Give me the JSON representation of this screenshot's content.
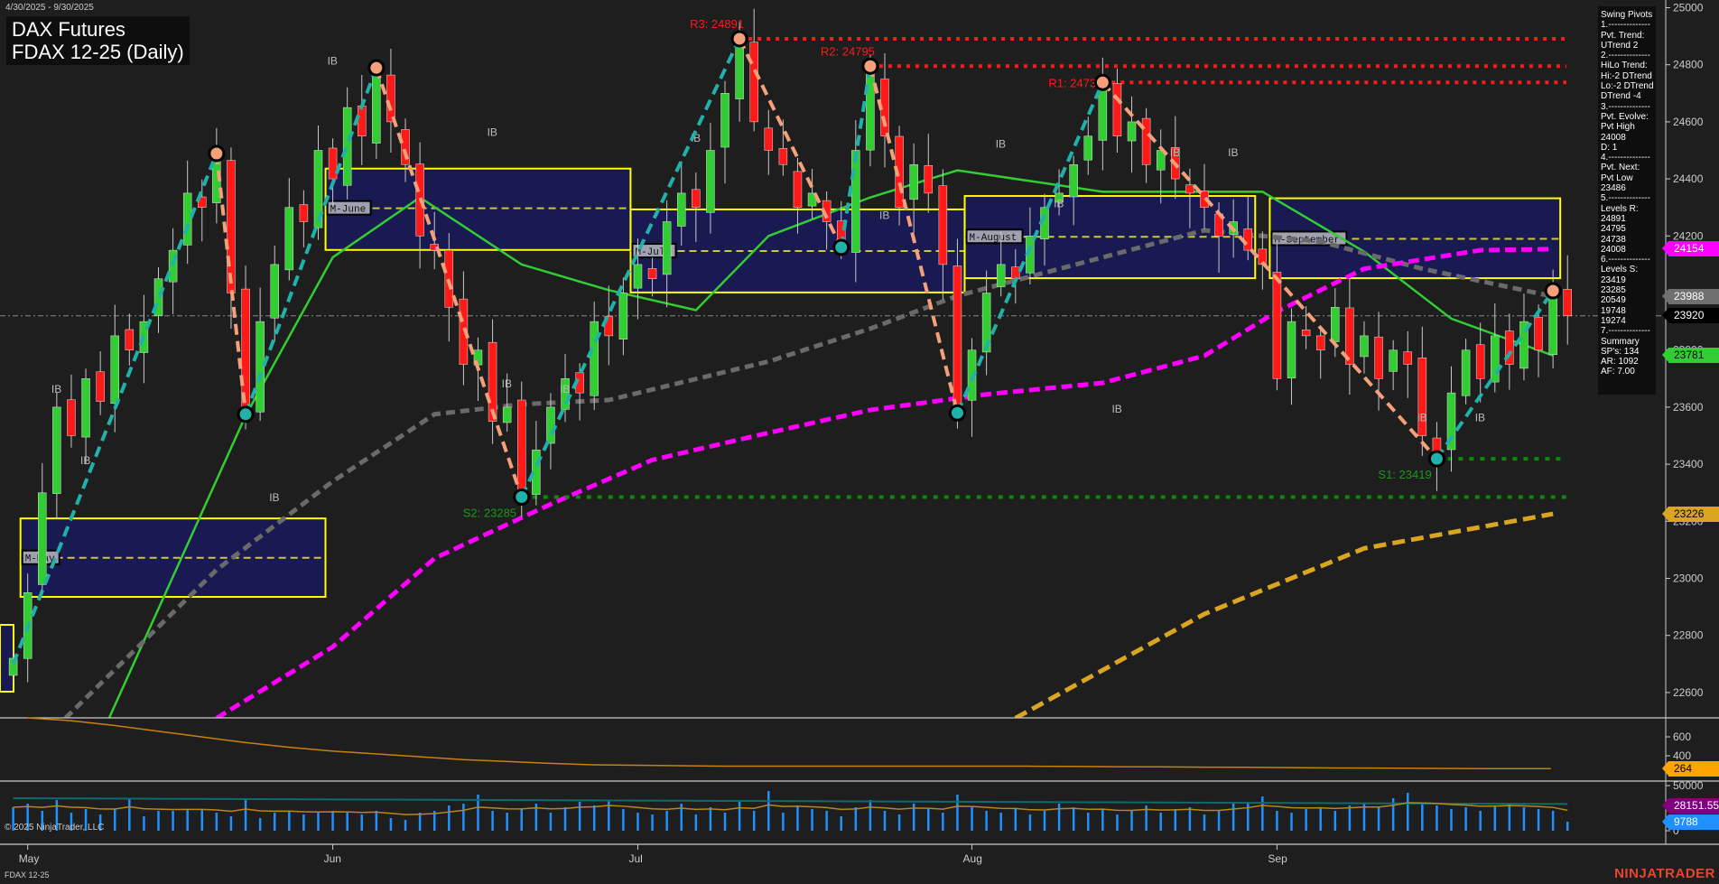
{
  "header": {
    "date_range": "4/30/2025 - 9/30/2025",
    "title": "DAX Futures",
    "subtitle": "FDAX 12-25 (Daily)"
  },
  "info_panel": {
    "lines": [
      "Swing Pivots",
      "1.--------------",
      "Pvt. Trend:",
      "UTrend 2",
      "2.--------------",
      "HiLo Trend:",
      "Hi:-2 DTrend",
      "Lo:-2 DTrend",
      "DTrend -4",
      "3.--------------",
      "Pvt. Evolve:",
      "Pvt High",
      "24008",
      "D: 1",
      "4.--------------",
      "Pvt. Next:",
      "Pvt Low",
      "23486",
      "5.--------------",
      "Levels R:",
      "24891",
      "24795",
      "24738",
      "24008",
      "6.--------------",
      "Levels S:",
      "23419",
      "23285",
      "20549",
      "19748",
      "19274",
      "7.--------------",
      "Summary",
      "SP's: 134",
      "AR: 1092",
      "AF: 7.00"
    ]
  },
  "footer": {
    "copyright": "© 2025 NinjaTrader, LLC",
    "symbol": "FDAX 12-25",
    "logo": "NINJATRADER"
  },
  "price_tags": [
    {
      "value": "24154",
      "bg": "#ff00ff",
      "fg": "#ffffff"
    },
    {
      "value": "23988",
      "bg": "#707070",
      "fg": "#ffffff"
    },
    {
      "value": "23920",
      "bg": "#000000",
      "fg": "#ffffff"
    },
    {
      "value": "23781",
      "bg": "#32cd32",
      "fg": "#000000"
    },
    {
      "value": "23226",
      "bg": "#daa520",
      "fg": "#000000"
    }
  ],
  "indicator_tags": [
    {
      "value": "264",
      "bg": "#ffa500",
      "fg": "#000000",
      "panel": "ind",
      "v": 264
    },
    {
      "value": "28151.55",
      "bg": "#800080",
      "fg": "#ffffff",
      "panel": "vol",
      "v": 28151
    },
    {
      "value": "9788",
      "bg": "#1e90ff",
      "fg": "#ffffff",
      "panel": "vol",
      "v": 9788
    }
  ],
  "chart_data": {
    "type": "candlestick",
    "title": "FDAX 12-25 (Daily)",
    "y_ticks": [
      22600,
      22800,
      23000,
      23200,
      23400,
      23600,
      23800,
      24000,
      24200,
      24400,
      24600,
      24800,
      25000
    ],
    "ylim": [
      22510,
      25030
    ],
    "x_labels": [
      {
        "label": "May",
        "bar": 1
      },
      {
        "label": "Jun",
        "bar": 22
      },
      {
        "label": "Jul",
        "bar": 43
      },
      {
        "label": "Aug",
        "bar": 66
      },
      {
        "label": "Sep",
        "bar": 87
      }
    ],
    "last_price": 23920,
    "closes": [
      22720,
      22950,
      23300,
      23600,
      23500,
      23700,
      23620,
      23850,
      23800,
      23900,
      24050,
      24150,
      24350,
      24300,
      24480,
      24000,
      23600,
      23900,
      24100,
      24300,
      24250,
      24500,
      24400,
      24650,
      24550,
      24760,
      24600,
      24450,
      24200,
      24150,
      23950,
      23750,
      23800,
      23550,
      23600,
      23300,
      23450,
      23600,
      23700,
      23650,
      23900,
      23850,
      24000,
      24100,
      24050,
      24250,
      24350,
      24300,
      24500,
      24700,
      24870,
      24600,
      24500,
      24450,
      24300,
      24350,
      24250,
      24170,
      24500,
      24780,
      24550,
      24300,
      24450,
      24350,
      24100,
      23600,
      23800,
      24000,
      24100,
      24050,
      24200,
      24300,
      24350,
      24450,
      24550,
      24720,
      24550,
      24600,
      24450,
      24500,
      24400,
      24350,
      24300,
      24200,
      24250,
      24150,
      24100,
      23700,
      23900,
      23850,
      23800,
      23950,
      23750,
      23850,
      23700,
      23800,
      23750,
      23500,
      23430,
      23650,
      23800,
      23700,
      23850,
      23750,
      23900,
      23800,
      24000,
      23920
    ],
    "swing_pivots": [
      [
        0,
        22700
      ],
      [
        14,
        24489
      ],
      [
        16,
        23575
      ],
      [
        25,
        24789
      ],
      [
        35,
        23285
      ],
      [
        50,
        24891
      ],
      [
        57,
        24160
      ],
      [
        59,
        24795
      ],
      [
        65,
        23580
      ],
      [
        75,
        24738
      ],
      [
        98,
        23419
      ],
      [
        106,
        24008
      ]
    ],
    "resistance": [
      {
        "label": "R3: 24891",
        "value": 24891,
        "from": 50
      },
      {
        "label": "R2: 24795",
        "value": 24795,
        "from": 59
      },
      {
        "label": "R1: 24738",
        "value": 24738,
        "from": 75
      }
    ],
    "support": [
      {
        "label": "S2: 23285",
        "value": 23285,
        "from": 35
      },
      {
        "label": "S1: 23419",
        "value": 23419,
        "from": 98
      }
    ],
    "monthly_boxes": [
      {
        "label": "M-May",
        "from": 1,
        "to": 21,
        "high": 23210,
        "low": 22935,
        "mid": 23072
      },
      {
        "label": "M-June",
        "from": 22,
        "to": 42,
        "high": 24436,
        "low": 24151,
        "mid": 24297
      },
      {
        "label": "M-July",
        "from": 43,
        "to": 65,
        "high": 24293,
        "low": 24002,
        "mid": 24147
      },
      {
        "label": "M-August",
        "from": 66,
        "to": 85,
        "high": 24340,
        "low": 24052,
        "mid": 24197
      },
      {
        "label": "M-September",
        "from": 87,
        "to": 106,
        "high": 24332,
        "low": 24052,
        "mid": 24190
      }
    ],
    "moving_averages": [
      {
        "name": "fast",
        "color": "#32cd32",
        "dash": "",
        "points": [
          [
            6.6,
            22510
          ],
          [
            16,
            23570
          ],
          [
            22,
            24125
          ],
          [
            28,
            24335
          ],
          [
            35,
            24100
          ],
          [
            41,
            24010
          ],
          [
            47,
            23940
          ],
          [
            52,
            24200
          ],
          [
            59,
            24335
          ],
          [
            65,
            24430
          ],
          [
            75,
            24355
          ],
          [
            86,
            24355
          ],
          [
            93,
            24145
          ],
          [
            99,
            23910
          ],
          [
            106,
            23781
          ]
        ]
      },
      {
        "name": "mid",
        "color": "#6a6a6a",
        "dash": "10 6",
        "points": [
          [
            3.6,
            22510
          ],
          [
            14,
            23030
          ],
          [
            22,
            23340
          ],
          [
            29,
            23575
          ],
          [
            35,
            23610
          ],
          [
            41,
            23625
          ],
          [
            52,
            23760
          ],
          [
            59,
            23875
          ],
          [
            65,
            23990
          ],
          [
            75,
            24125
          ],
          [
            82,
            24220
          ],
          [
            90,
            24180
          ],
          [
            97,
            24085
          ],
          [
            106,
            23988
          ]
        ]
      },
      {
        "name": "slow",
        "color": "#ff00ff",
        "dash": "12 6",
        "points": [
          [
            14,
            22510
          ],
          [
            22,
            22760
          ],
          [
            29,
            23070
          ],
          [
            37,
            23260
          ],
          [
            44,
            23415
          ],
          [
            52,
            23510
          ],
          [
            59,
            23590
          ],
          [
            67,
            23645
          ],
          [
            75,
            23685
          ],
          [
            82,
            23780
          ],
          [
            87,
            23935
          ],
          [
            93,
            24085
          ],
          [
            101,
            24150
          ],
          [
            106,
            24154
          ]
        ]
      },
      {
        "name": "long",
        "color": "#daa520",
        "dash": "14 7",
        "points": [
          [
            69,
            22510
          ],
          [
            82,
            22875
          ],
          [
            93,
            23105
          ],
          [
            106,
            23226
          ]
        ]
      }
    ],
    "ib_labels": [
      [
        3,
        23650
      ],
      [
        18,
        23270
      ],
      [
        34,
        23670
      ],
      [
        5,
        23400
      ],
      [
        22,
        24800
      ],
      [
        33,
        24550
      ],
      [
        38,
        23650
      ],
      [
        47,
        24530
      ],
      [
        60,
        24260
      ],
      [
        68,
        24510
      ],
      [
        72,
        24300
      ],
      [
        76,
        23580
      ],
      [
        80,
        24480
      ],
      [
        84,
        24480
      ],
      [
        97,
        23550
      ],
      [
        101,
        23550
      ]
    ],
    "indicator": {
      "ticks": [
        400,
        600
      ],
      "values": [
        800,
        770,
        720,
        660,
        600,
        540,
        490,
        450,
        420,
        390,
        360,
        340,
        320,
        305,
        300,
        295,
        290,
        290,
        290,
        290,
        290,
        290,
        290,
        290,
        288,
        285,
        283,
        280,
        278,
        275,
        272,
        270,
        268,
        266,
        264,
        264
      ]
    },
    "volume": {
      "ticks": [
        0,
        50000
      ],
      "values": [
        26,
        30,
        22,
        34,
        20,
        24,
        18,
        24,
        36,
        16,
        22,
        22,
        24,
        24,
        20,
        16,
        34,
        14,
        20,
        22,
        18,
        20,
        22,
        20,
        18,
        22,
        14,
        12,
        20,
        22,
        28,
        30,
        40,
        22,
        20,
        24,
        30,
        20,
        26,
        32,
        28,
        34,
        24,
        20,
        18,
        22,
        30,
        18,
        26,
        20,
        34,
        22,
        44,
        20,
        28,
        24,
        22,
        16,
        26,
        34,
        22,
        18,
        30,
        24,
        20,
        40,
        26,
        22,
        20,
        24,
        18,
        22,
        30,
        26,
        20,
        24,
        18,
        22,
        28,
        20,
        24,
        26,
        18,
        22,
        30,
        32,
        38,
        22,
        20,
        24,
        26,
        22,
        28,
        30,
        26,
        36,
        42,
        30,
        28,
        24,
        26,
        22,
        28,
        30,
        26,
        24,
        22,
        10
      ],
      "unit": 1000
    }
  }
}
